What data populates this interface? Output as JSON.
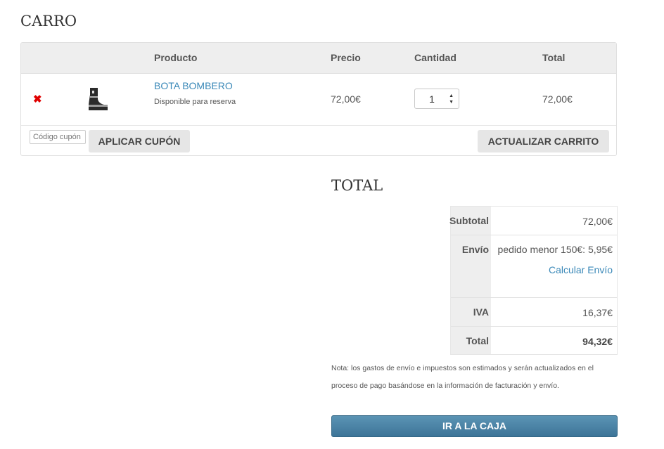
{
  "page_title": "CARRO",
  "cart": {
    "headers": {
      "producto": "Producto",
      "precio": "Precio",
      "cantidad": "Cantidad",
      "total": "Total"
    },
    "items": [
      {
        "name": "BOTA BOMBERO",
        "availability": "Disponible para reserva",
        "price": "72,00€",
        "quantity": "1",
        "total": "72,00€"
      }
    ],
    "coupon_placeholder": "Código cupón",
    "apply_coupon_label": "APLICAR CUPÓN",
    "update_cart_label": "ACTUALIZAR CARRITO"
  },
  "totals": {
    "title": "TOTAL",
    "subtotal_label": "Subtotal",
    "subtotal_value": "72,00€",
    "shipping_label": "Envío",
    "shipping_value": "pedido menor 150€: 5,95€",
    "calculate_shipping_label": "Calcular Envío",
    "tax_label": "IVA",
    "tax_value": "16,37€",
    "total_label": "Total",
    "total_value": "94,32€"
  },
  "note": "Nota: los gastos de envío e impuestos son estimados y serán actualizados en el proceso de pago basándose en la información de facturación y envío.",
  "checkout_label": "IR A LA CAJA",
  "colors": {
    "link": "#3b89b8",
    "remove": "#e00000",
    "checkout": "#4a81a5"
  },
  "icons": {
    "remove": "remove-x-icon",
    "qty": "up-down-arrows-icon"
  }
}
